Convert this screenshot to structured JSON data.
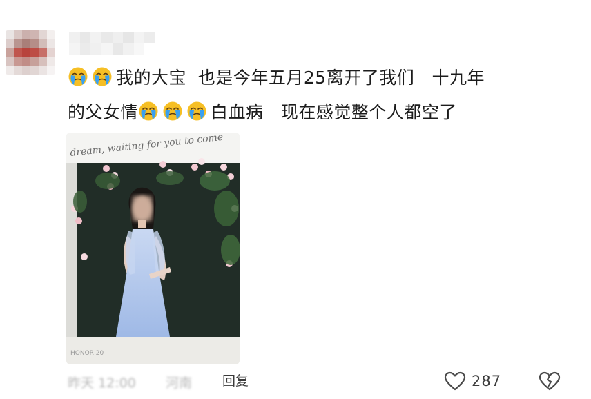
{
  "comment": {
    "segments": [
      {
        "emoji": 2
      },
      {
        "text": "我的大宝  也是今年五月25离开了我们   十九年"
      },
      {
        "break": true
      },
      {
        "text": "的父女情"
      },
      {
        "emoji": 3
      },
      {
        "text": "白血病   现在感觉整个人都空了"
      }
    ],
    "emoji_name": "crying-emoji"
  },
  "photo": {
    "banner_text": "dream, waiting for you to come",
    "watermark": "HONOR 20"
  },
  "footer": {
    "time": "昨天 12:00",
    "location": "河南",
    "reply_label": "回复",
    "like_count": "287"
  },
  "colors": {
    "accent_text": "#3a3a3a",
    "meta_text": "#b5b5b5",
    "dress": "#aac4ec",
    "hedge": "#1f2a24",
    "emoji_face": "#f6bf25",
    "emoji_tear": "#3aa0f0"
  },
  "icons": {
    "like": "heart-outline-icon",
    "dislike": "broken-heart-icon"
  }
}
